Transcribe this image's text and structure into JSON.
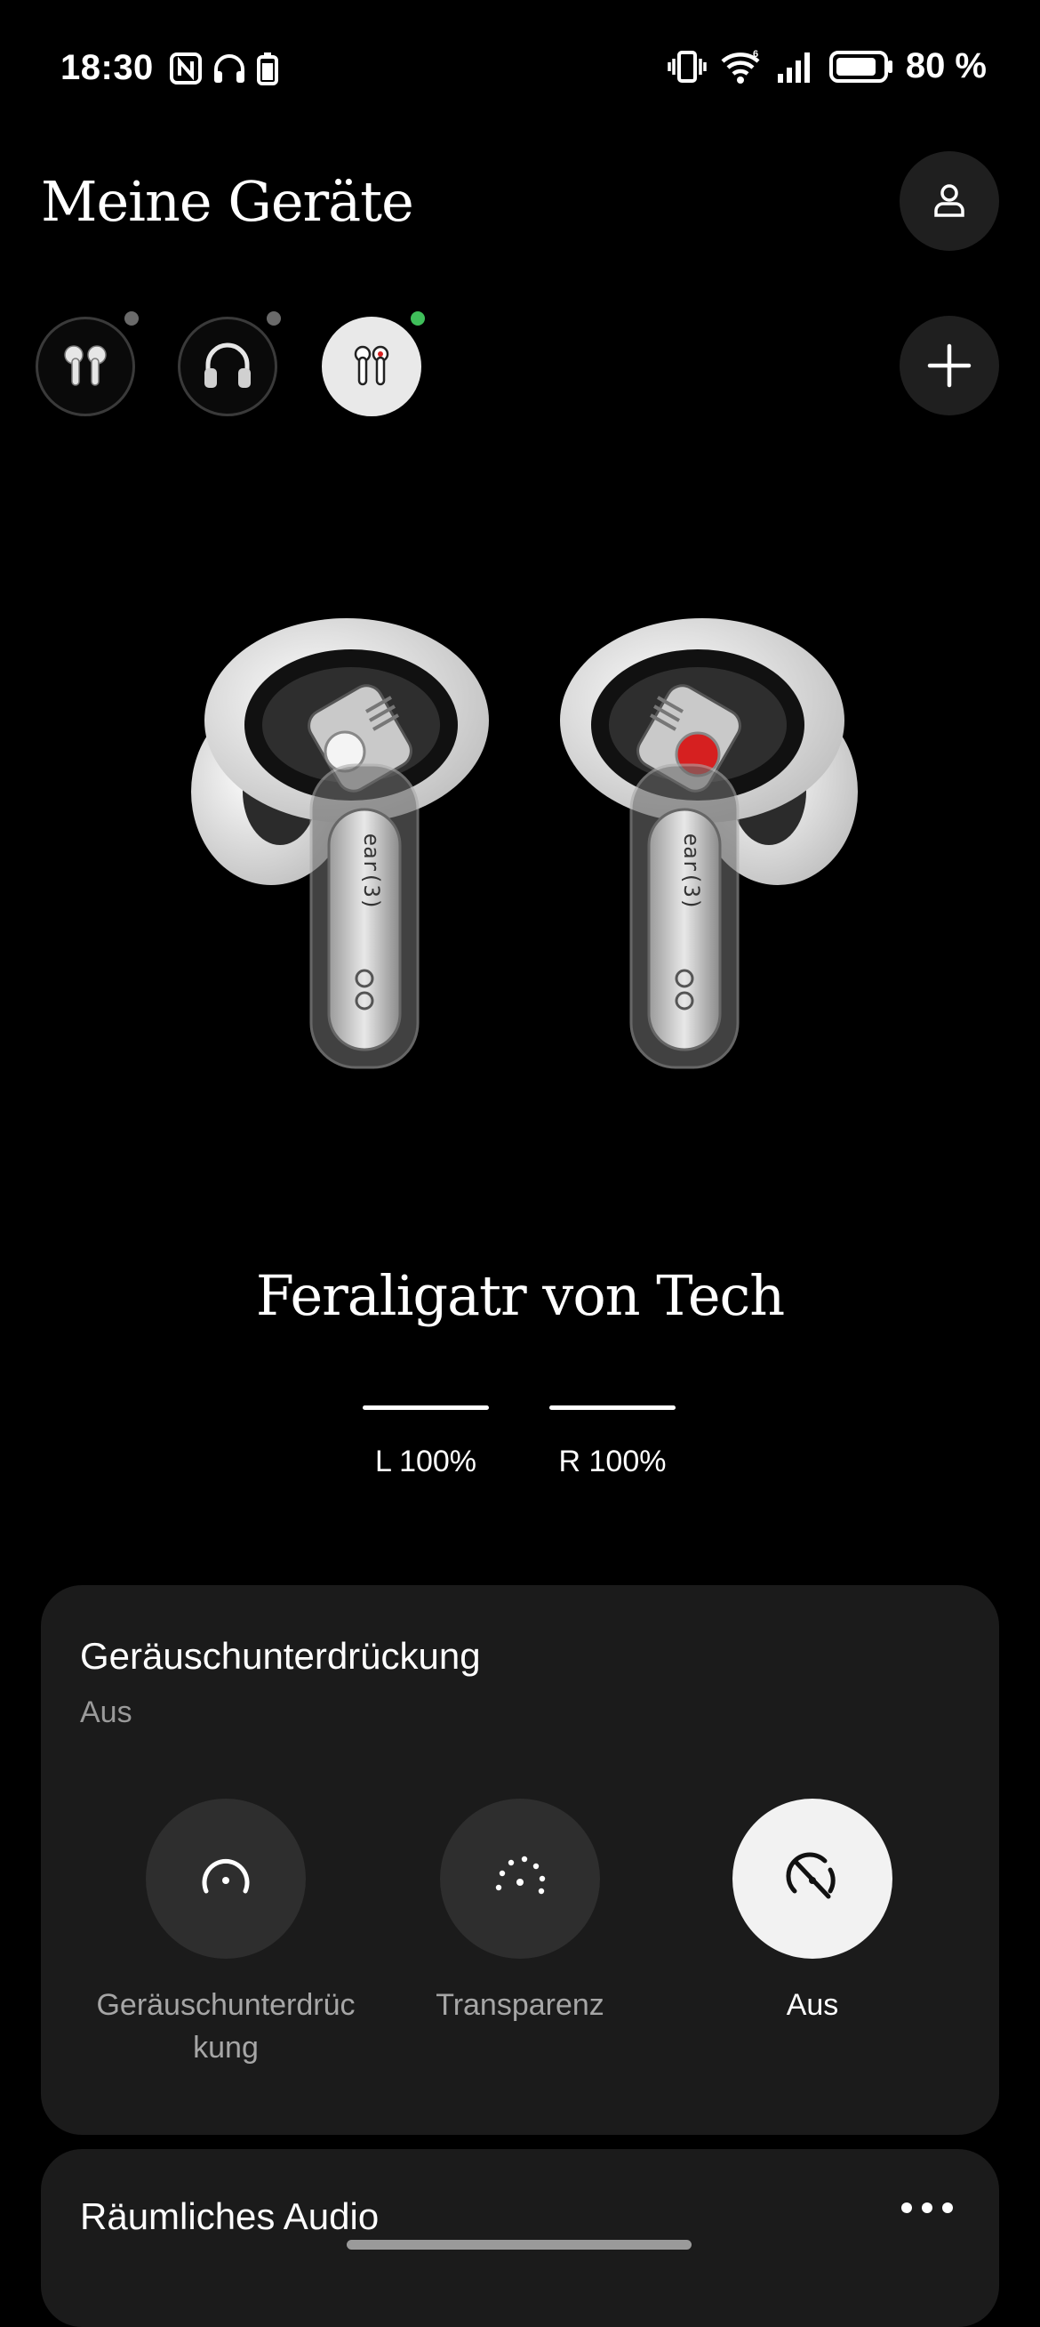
{
  "status_bar": {
    "time": "18:30",
    "battery_percent": "80 %",
    "icons": [
      "nfc-icon",
      "headphones-icon",
      "earbuds-battery-icon",
      "vibrate-icon",
      "wifi-6-icon",
      "signal-icon",
      "battery-icon"
    ]
  },
  "header": {
    "title": "Meine Geräte"
  },
  "devices": [
    {
      "icon": "earbuds-icon",
      "status_color": "#6a6a6a",
      "active": false
    },
    {
      "icon": "headphones-icon",
      "status_color": "#6a6a6a",
      "active": false
    },
    {
      "icon": "earbuds-icon",
      "status_color": "#3fbf5a",
      "active": true
    }
  ],
  "device": {
    "name": "Feraligatr von Tech",
    "battery_left": "L 100%",
    "battery_right": "R 100%",
    "battery_left_level": 1.0,
    "battery_right_level": 1.0
  },
  "noise_card": {
    "title": "Geräuschunterdrückung",
    "subtitle": "Aus",
    "modes": [
      {
        "label": "Geräuschunterdrüc kung",
        "icon": "anc-icon",
        "active": false
      },
      {
        "label": "Transparenz",
        "icon": "transparency-icon",
        "active": false
      },
      {
        "label": "Aus",
        "icon": "off-icon",
        "active": true
      }
    ]
  },
  "spatial_card": {
    "title": "Räumliches Audio",
    "more_icon": "more-icon"
  },
  "colors": {
    "accent_red": "#d62020",
    "status_green": "#3fbf5a",
    "card_bg": "#1b1b1b"
  }
}
